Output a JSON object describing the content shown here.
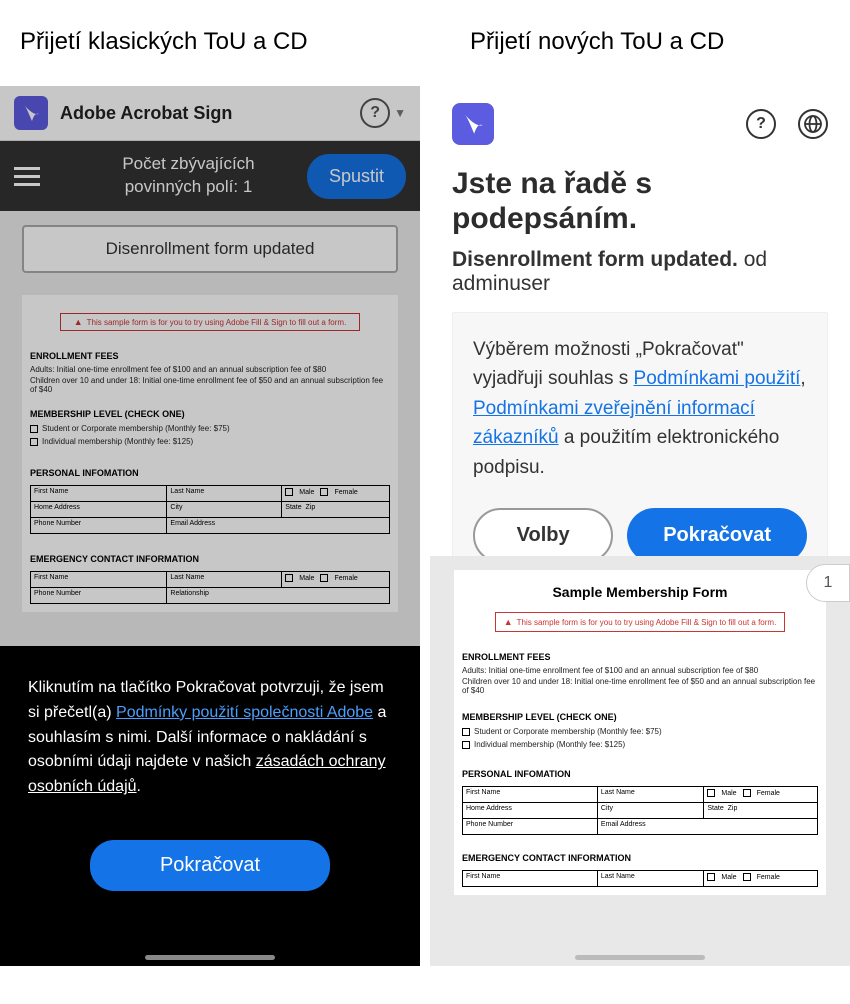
{
  "labels": {
    "left": "Přijetí klasických ToU a CD",
    "right": "Přijetí nových ToU a CD"
  },
  "left": {
    "app_name": "Adobe Acrobat Sign",
    "fields_line1": "Počet zbývajících",
    "fields_line2": "povinných polí: 1",
    "start": "Spustit",
    "form_title": "Disenrollment form updated",
    "footer_text1": "Kliknutím na tlačítko Pokračovat potvrzuji, že jsem si přečetl(a) ",
    "footer_link1": "Podmínky použití společnosti Adobe",
    "footer_text2": " a souhlasím s nimi. Další informace o nakládání s osobními údaji najdete v našich ",
    "footer_link2": "zásadách ochrany osobních údajů",
    "footer_text3": ".",
    "continue": "Pokračovat"
  },
  "right": {
    "heading": "Jste na řadě s podepsáním.",
    "sub_doc": "Disenrollment form updated.",
    "sub_od": " od ",
    "sub_user": "adminuser",
    "consent_pre": "Výběrem možnosti „Pokračovat\" vyjadřuji souhlas s ",
    "consent_link1": "Podmínkami použití",
    "consent_sep": ", ",
    "consent_link2": "Podmínkami zveřejnění informací zákazníků",
    "consent_post": " a použitím elektronického podpisu.",
    "options": "Volby",
    "continue": "Pokračovat",
    "page": "1"
  },
  "doc": {
    "warn": "This sample form is for you to try using Adobe Fill & Sign to fill out a form.",
    "title": "Sample Membership Form",
    "enroll_h": "ENROLLMENT FEES",
    "enroll_l1": "Adults: Initial one-time enrollment fee of $100 and an annual subscription fee of $80",
    "enroll_l2": "Children over 10 and under 18: Initial one-time enrollment fee of $50 and an annual subscription fee of $40",
    "level_h": "MEMBERSHIP LEVEL (CHECK ONE)",
    "level_opt1": "Student or Corporate membership (Monthly fee: $75)",
    "level_opt2": "Individual membership (Monthly fee: $125)",
    "personal_h": "PERSONAL INFOMATION",
    "first": "First Name",
    "last": "Last Name",
    "male": "Male",
    "female": "Female",
    "home": "Home Address",
    "city": "City",
    "state": "State",
    "zip": "Zip",
    "phone": "Phone Number",
    "email": "Email Address",
    "emerg_h": "EMERGENCY CONTACT INFORMATION",
    "relation": "Relationship"
  }
}
